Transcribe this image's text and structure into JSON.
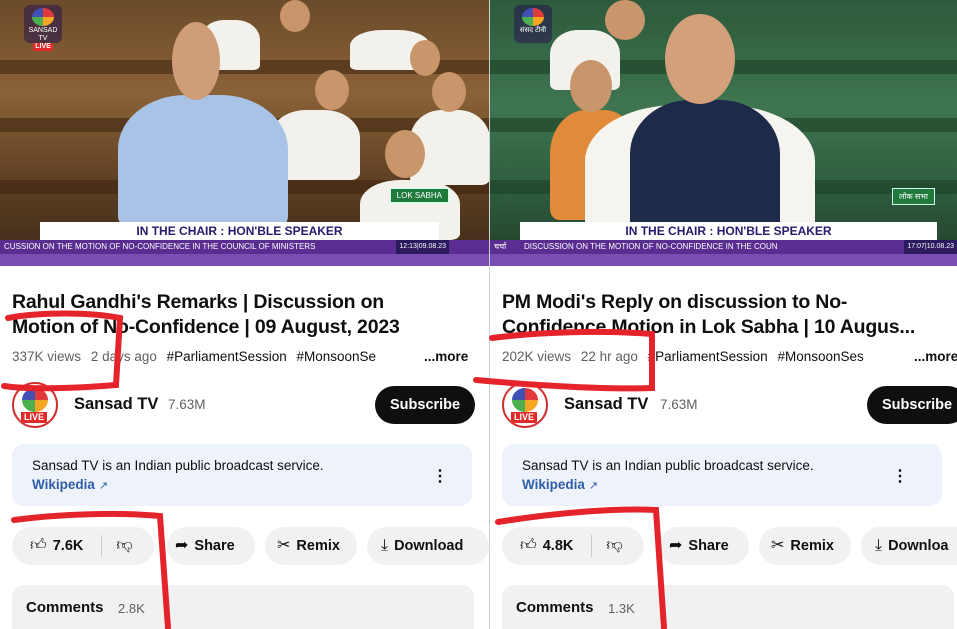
{
  "colors": {
    "annotation": "#e5232a",
    "subscribe_bg": "#0f0f0f",
    "link": "#2f5da8",
    "pill_bg": "#f1f1f1"
  },
  "left": {
    "video": {
      "logo_line1": "SANSAD TV",
      "logo_live": "LIVE",
      "badge": "LOK SABHA",
      "chair_text": "IN THE CHAIR : HON'BLE SPEAKER",
      "ticker": "CUSSION ON THE MOTION OF NO-CONFIDENCE IN THE COUNCIL OF MINISTERS",
      "time": "12:13|09.08.23"
    },
    "title_line1": "Rahul Gandhi's Remarks | Discussion on",
    "title_line2": "Motion of No-Confidence | 09 August, 2023",
    "views": "337K views",
    "age": "2 days ago",
    "tag1": "#ParliamentSession",
    "tag2": "#MonsoonSe",
    "more": "...more",
    "channel": {
      "name": "Sansad TV",
      "subs": "7.63M",
      "subscribe": "Subscribe",
      "avatar_tag": "LIVE"
    },
    "description": {
      "text": "Sansad TV is an Indian public broadcast service.",
      "link": "Wikipedia"
    },
    "actions": {
      "likes": "7.6K",
      "share": "Share",
      "remix": "Remix",
      "download": "Download"
    },
    "comments": {
      "label": "Comments",
      "count": "2.8K"
    }
  },
  "right": {
    "video": {
      "logo_line1": "संसद टीवी",
      "badge": "लोक सभा",
      "chair_text": "IN THE CHAIR : HON'BLE SPEAKER",
      "ticker_prefix": "चर्चा",
      "ticker": "DISCUSSION ON THE MOTION OF NO-CONFIDENCE IN THE COUN",
      "time": "17:07|10.08.23"
    },
    "title_line1": "PM Modi's Reply on discussion to No-",
    "title_line2": "Confidence Motion in Lok Sabha | 10 Augus...",
    "views": "202K views",
    "age": "22 hr ago",
    "tag1": "#ParliamentSession",
    "tag2": "#MonsoonSes",
    "more": "...more",
    "channel": {
      "name": "Sansad TV",
      "subs": "7.63M",
      "subscribe": "Subscribe",
      "avatar_tag": "LIVE"
    },
    "description": {
      "text": "Sansad TV is an Indian public broadcast service.",
      "link": "Wikipedia"
    },
    "actions": {
      "likes": "4.8K",
      "share": "Share",
      "remix": "Remix",
      "download": "Downloa"
    },
    "comments": {
      "label": "Comments",
      "count": "1.3K"
    }
  }
}
